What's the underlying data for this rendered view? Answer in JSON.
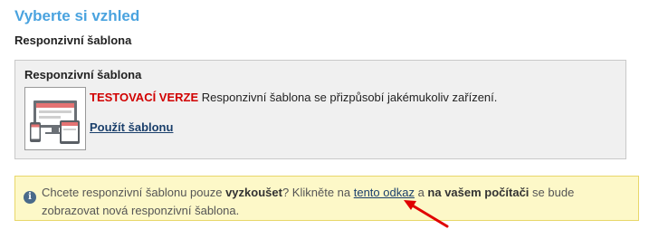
{
  "header": {
    "title": "Vyberte si vzhled",
    "subtitle": "Responzivní šablona"
  },
  "template": {
    "name": "Responzivní šablona",
    "badge": "TESTOVACÍ VERZE",
    "description": " Responzivní šablona se přizpůsobí jakémukoliv zařízení.",
    "use_link": "Použít šablonu",
    "thumbnail_icon": "responsive-devices-icon"
  },
  "info": {
    "icon": "info-icon",
    "text_1": "Chcete responzivní šablonu pouze ",
    "bold_1": "vyzkoušet",
    "text_2": "? Klikněte na ",
    "link": "tento odkaz",
    "text_3": " a ",
    "bold_2": "na vašem počítači",
    "text_4": " se bude zobrazovat nová responzivní šablona."
  },
  "colors": {
    "title": "#4aa3df",
    "warning": "#d10000",
    "info_bg": "#fdf8c8",
    "arrow": "#e00000"
  }
}
